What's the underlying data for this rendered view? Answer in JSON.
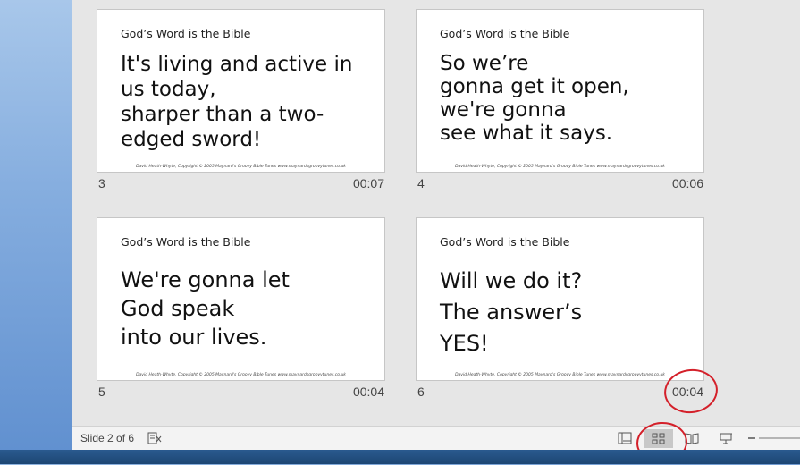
{
  "slides": [
    {
      "header": "God’s Word is the Bible",
      "lines": [
        "It's living and active in",
        "us today,",
        "sharper than a two-",
        "edged sword!"
      ],
      "footer": "David Heath-Whyte, Copyright © 2005 Maynard's Groovy Bible Tunes www.maynardsgroovytunes.co.uk",
      "number": "3",
      "time": "00:07"
    },
    {
      "header": "God’s Word is the Bible",
      "lines": [
        "So we’re",
        "gonna get it open,",
        "we're gonna",
        "see what it says."
      ],
      "footer": "David Heath-Whyte, Copyright © 2005 Maynard's Groovy Bible Tunes www.maynardsgroovytunes.co.uk",
      "number": "4",
      "time": "00:06"
    },
    {
      "header": "God’s Word is the Bible",
      "lines": [
        "We're gonna let",
        "God speak",
        "into our lives."
      ],
      "footer": "David Heath-Whyte, Copyright © 2005 Maynard's Groovy Bible Tunes www.maynardsgroovytunes.co.uk",
      "number": "5",
      "time": "00:04"
    },
    {
      "header": "God’s Word is the Bible",
      "lines": [
        "Will we do it?",
        "The answer’s",
        "YES!"
      ],
      "footer": "David Heath-Whyte, Copyright © 2005 Maynard's Groovy Bible Tunes www.maynardsgroovytunes.co.uk",
      "number": "6",
      "time": "00:04"
    }
  ],
  "statusbar": {
    "slide_indicator": "Slide 2 of 6",
    "icons": [
      "spellcheck-icon",
      "normal-view-icon",
      "slide-sorter-view-icon",
      "reading-view-icon",
      "slide-show-icon",
      "zoom-slider"
    ],
    "active_view": "slide-sorter-view-icon"
  },
  "colors": {
    "annotation": "#d4202a",
    "workspace": "#e6e6e6",
    "statusbar": "#f3f3f3"
  }
}
